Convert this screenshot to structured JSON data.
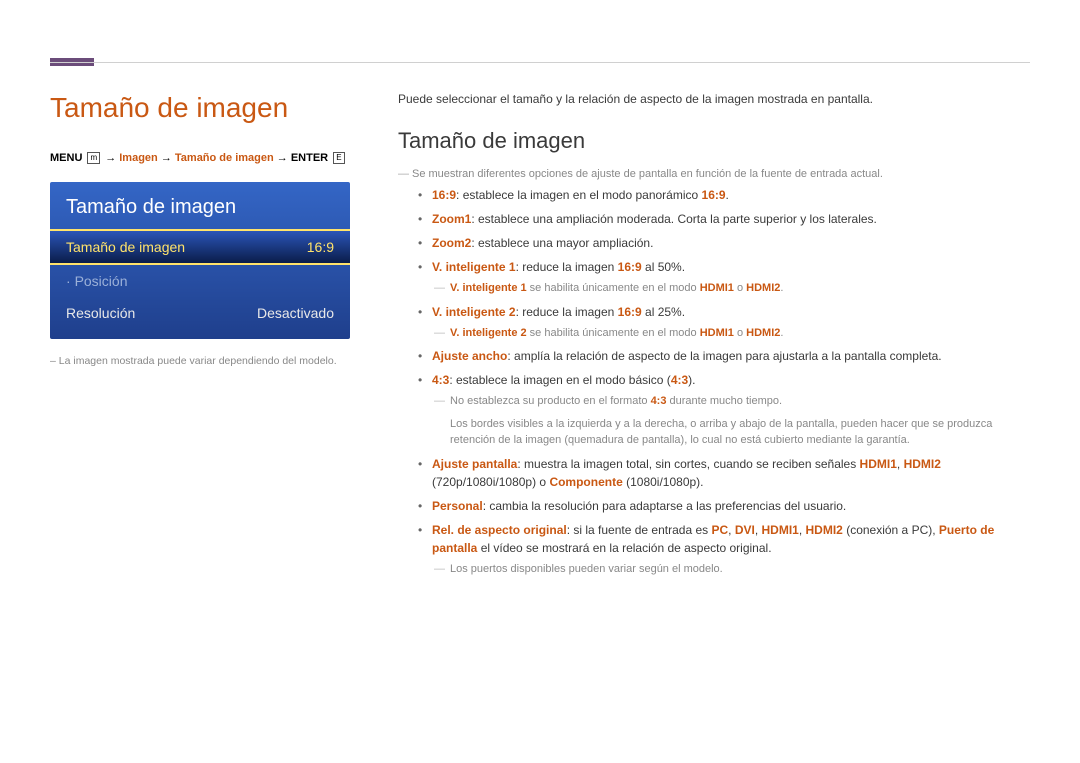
{
  "page_title": "Tamaño de imagen",
  "breadcrumb": {
    "prefix": "MENU",
    "menu_icon": "m",
    "arrow": "→",
    "path1": "Imagen",
    "path2": "Tamaño de imagen",
    "suffix": "ENTER",
    "enter_icon": "E"
  },
  "osd": {
    "title": "Tamaño de imagen",
    "rows": [
      {
        "label": "Tamaño de imagen",
        "value": "16:9",
        "selected": true
      },
      {
        "label": "Posición",
        "value": "",
        "dim": true
      },
      {
        "label": "Resolución",
        "value": "Desactivado"
      }
    ]
  },
  "caption": "La imagen mostrada puede variar dependiendo del modelo.",
  "intro": "Puede seleccionar el tamaño y la relación de aspecto de la imagen mostrada en pantalla.",
  "section_title": "Tamaño de imagen",
  "section_note": "Se muestran diferentes opciones de ajuste de pantalla en función de la fuente de entrada actual.",
  "items": {
    "i1": {
      "k": "16:9",
      "t": ": establece la imagen en el modo panorámico ",
      "k2": "16:9",
      "tail": "."
    },
    "i2": {
      "k": "Zoom1",
      "t": ": establece una ampliación moderada. Corta la parte superior y los laterales."
    },
    "i3": {
      "k": "Zoom2",
      "t": ": establece una mayor ampliación."
    },
    "i4": {
      "k": "V. inteligente 1",
      "t": ": reduce la imagen ",
      "k2": "16:9",
      "tail": " al 50%."
    },
    "i4n_a": "V. inteligente 1",
    "i4n_b": " se habilita únicamente en el modo ",
    "i4n_c": "HDMI1",
    "i4n_d": " o ",
    "i4n_e": "HDMI2",
    "i4n_f": ".",
    "i5": {
      "k": "V. inteligente 2",
      "t": ": reduce la imagen ",
      "k2": "16:9",
      "tail": " al 25%."
    },
    "i5n_a": "V. inteligente 2",
    "i5n_b": "  se habilita únicamente en el modo ",
    "i5n_c": "HDMI1",
    "i5n_d": " o ",
    "i5n_e": "HDMI2",
    "i5n_f": ".",
    "i6": {
      "k": "Ajuste ancho",
      "t": ": amplía la relación de aspecto de la imagen para ajustarla a la pantalla completa."
    },
    "i7": {
      "k": "4:3",
      "t": ": establece la imagen en el modo básico (",
      "k2": "4:3",
      "tail": ")."
    },
    "i7n1_a": "No establezca su producto en el formato ",
    "i7n1_b": "4:3",
    "i7n1_c": " durante mucho tiempo.",
    "i7n2": "Los bordes visibles a la izquierda y a la derecha, o arriba y abajo de la pantalla, pueden hacer que se produzca retención de la imagen (quemadura de pantalla), lo cual no está cubierto mediante la garantía.",
    "i8": {
      "k": "Ajuste pantalla",
      "t": ": muestra la imagen total, sin cortes, cuando se reciben señales ",
      "h1": "HDMI1",
      "c1": ", ",
      "h2": "HDMI2",
      "t2": " (720p/1080i/1080p) o ",
      "h3": "Componente",
      "t3": " (1080i/1080p)."
    },
    "i9": {
      "k": "Personal",
      "t": ": cambia la resolución para adaptarse a las preferencias del usuario."
    },
    "i10": {
      "k": "Rel. de aspecto original",
      "t": ": si la fuente de entrada es ",
      "h1": "PC",
      "c1": ", ",
      "h2": "DVI",
      "c2": ", ",
      "h3": "HDMI1",
      "c3": ", ",
      "h4": "HDMI2",
      "t2": " (conexión a PC), ",
      "h5": "Puerto de pantalla",
      "t3": " el vídeo se mostrará en la relación de aspecto original."
    },
    "i10n": "Los puertos disponibles pueden variar según el modelo."
  }
}
